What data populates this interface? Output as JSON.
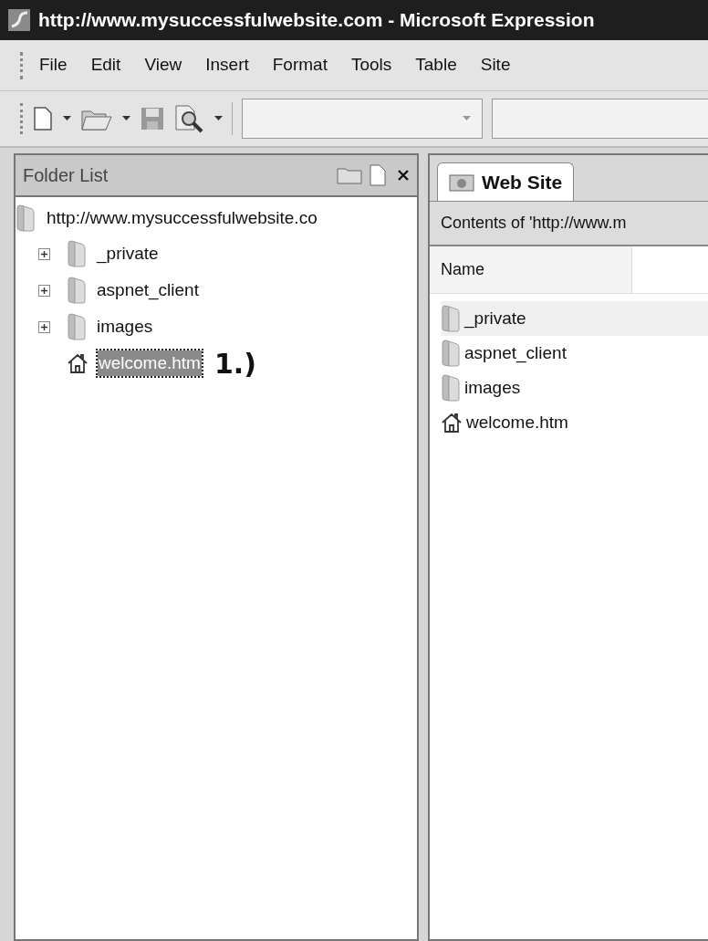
{
  "window": {
    "title": "http://www.mysuccessfulwebsite.com - Microsoft Expression"
  },
  "menu": [
    "File",
    "Edit",
    "View",
    "Insert",
    "Format",
    "Tools",
    "Table",
    "Site"
  ],
  "folder_list": {
    "title": "Folder List",
    "tree": {
      "label": "http://www.mysuccessfulwebsite.co",
      "kind": "site",
      "selected": false,
      "children": [
        {
          "label": "_private",
          "kind": "folder",
          "expanded": false,
          "selected": false
        },
        {
          "label": "aspnet_client",
          "kind": "folder",
          "expanded": false,
          "selected": false
        },
        {
          "label": "images",
          "kind": "folder",
          "expanded": false,
          "selected": false
        },
        {
          "label": "welcome.htm",
          "kind": "home",
          "selected": true
        }
      ]
    },
    "annotation": "1.)"
  },
  "tabs": [
    {
      "label": "Web Site",
      "selected": true
    }
  ],
  "contents": {
    "caption": "Contents of 'http://www.m",
    "columns": [
      "Name"
    ],
    "rows": [
      {
        "name": "_private",
        "kind": "folder",
        "selected": true
      },
      {
        "name": "aspnet_client",
        "kind": "folder",
        "selected": false
      },
      {
        "name": "images",
        "kind": "folder",
        "selected": false
      },
      {
        "name": "welcome.htm",
        "kind": "home",
        "selected": false
      }
    ]
  }
}
